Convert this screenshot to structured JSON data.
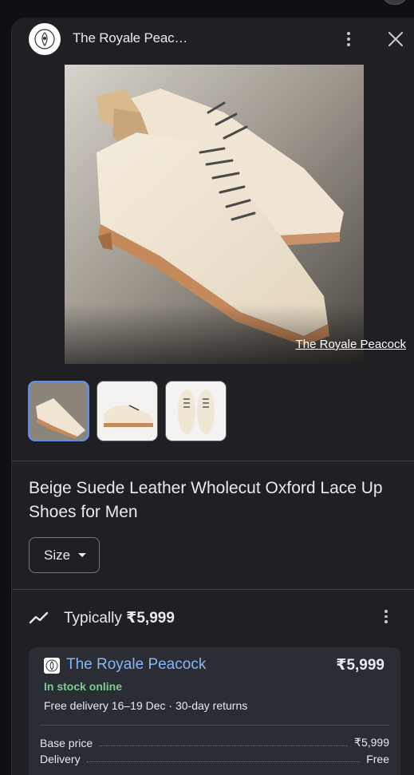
{
  "header": {
    "store_name": "The Royale Peac…"
  },
  "image": {
    "credit": "The Royale Peacock"
  },
  "thumbnails": [
    {
      "label": "thumbnail-1",
      "selected": true
    },
    {
      "label": "thumbnail-2",
      "selected": false
    },
    {
      "label": "thumbnail-3",
      "selected": false
    }
  ],
  "product": {
    "title": "Beige Suede Leather Wholecut Oxford Lace Up Shoes for Men",
    "size_label": "Size"
  },
  "pricing": {
    "typically_label": "Typically",
    "typically_price": "₹5,999"
  },
  "seller": {
    "name": "The Royale Peacock",
    "price": "₹5,999",
    "stock": "In stock online",
    "delivery": "Free delivery 16–19 Dec · 30-day returns",
    "lines": [
      {
        "label": "Base price",
        "value": "₹5,999"
      },
      {
        "label": "Delivery",
        "value": "Free"
      }
    ]
  },
  "colors": {
    "accent_link": "#8ab4f8",
    "in_stock": "#81c995",
    "selection": "#5b8def"
  }
}
